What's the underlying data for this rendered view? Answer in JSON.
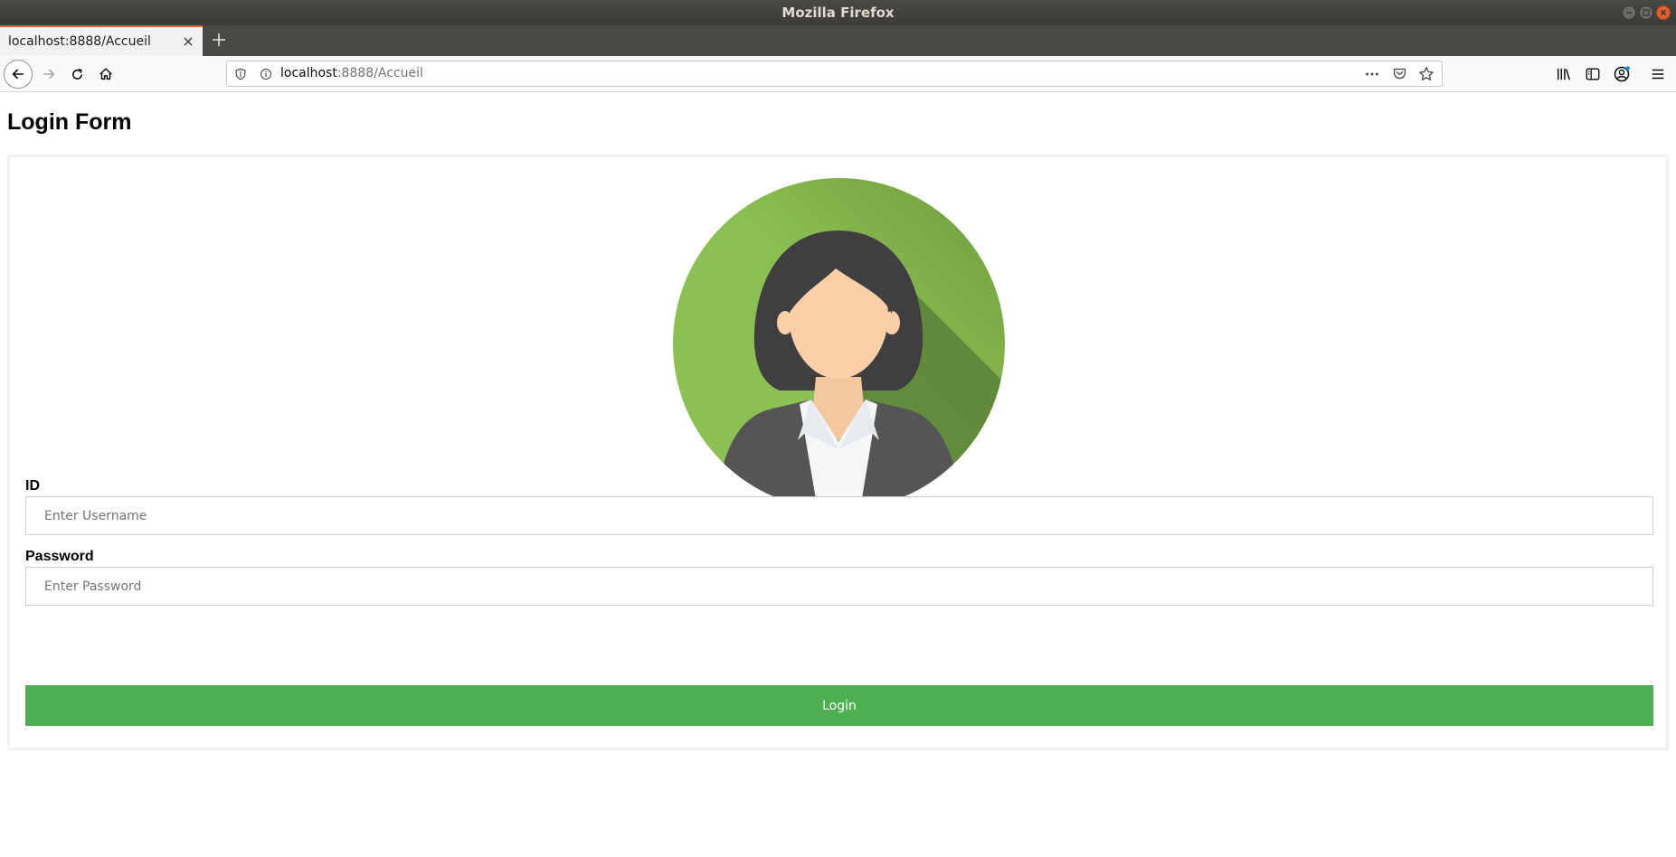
{
  "window": {
    "title": "Mozilla Firefox"
  },
  "tab": {
    "title": "localhost:8888/Accueil"
  },
  "urlbar": {
    "host": "localhost",
    "path": ":8888/Accueil"
  },
  "page": {
    "title": "Login Form",
    "id_label": "ID",
    "username_placeholder": "Enter Username",
    "password_label": "Password",
    "password_placeholder": "Enter Password",
    "login_label": "Login"
  },
  "colors": {
    "accent": "#4caf50",
    "tab_highlight": "#e66029"
  },
  "icons": [
    "back-arrow-icon",
    "forward-arrow-icon",
    "reload-icon",
    "home-icon",
    "shield-icon",
    "info-icon",
    "more-icon",
    "pocket-icon",
    "star-icon",
    "library-icon",
    "sidebar-icon",
    "account-icon",
    "menu-icon",
    "plus-icon",
    "close-icon",
    "avatar-icon"
  ]
}
